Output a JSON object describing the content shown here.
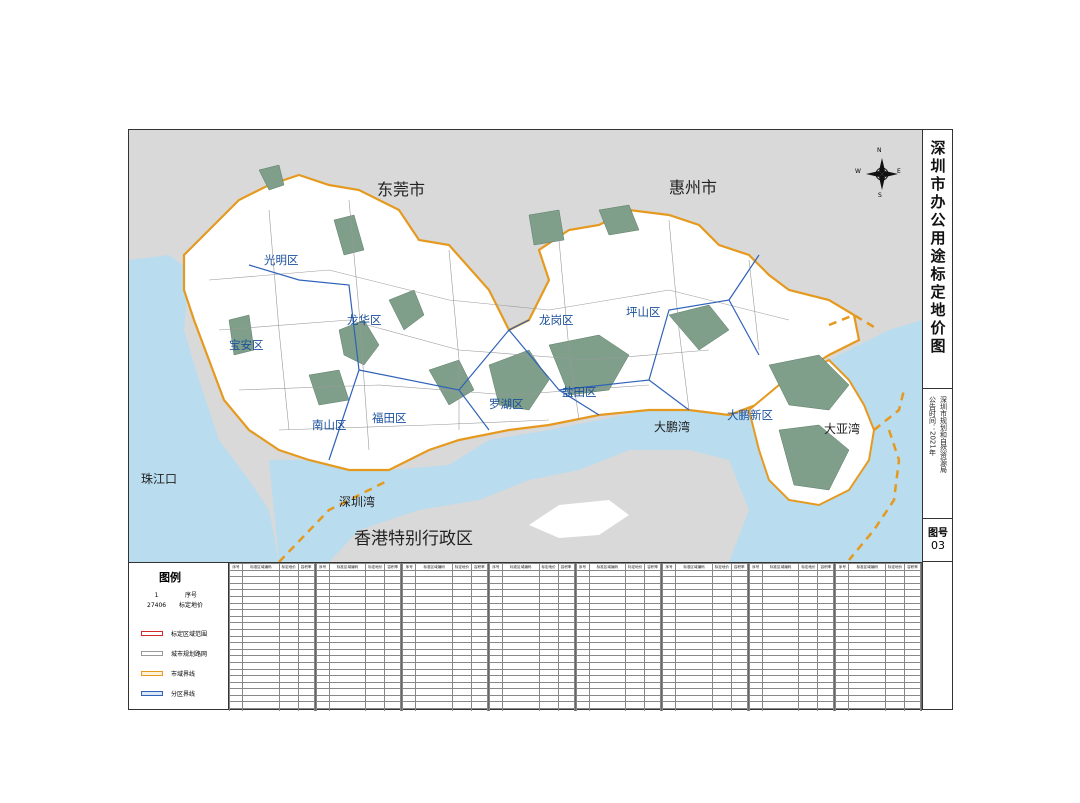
{
  "title": "深圳市办公用途标定地价图",
  "announce_date": "公告时间：2021年",
  "publisher": "深圳市规划和自然资源局",
  "figure_label": "图号",
  "figure_number": "03",
  "neighbors": {
    "dongguan": "东莞市",
    "huizhou": "惠州市",
    "hongkong": "香港特别行政区"
  },
  "waters": {
    "pearl_river": "珠江口",
    "shenzhen_bay": "深圳湾",
    "dapeng_bay": "大鹏湾",
    "daya_bay": "大亚湾"
  },
  "districts": {
    "guangming": "光明区",
    "baoan": "宝安区",
    "longhua": "龙华区",
    "longgang": "龙岗区",
    "pingshan": "坪山区",
    "nanshan": "南山区",
    "futian": "福田区",
    "luohu": "罗湖区",
    "yantian": "盐田区",
    "dapeng": "大鹏新区"
  },
  "compass": {
    "n": "N",
    "s": "S",
    "e": "E",
    "w": "W"
  },
  "legend": {
    "title": "图例",
    "sample_number": "1",
    "sample_price": "27406",
    "desc_number": "序号",
    "desc_price": "标定地价",
    "items": [
      {
        "label": "标定区域范围",
        "color": "#d42a2a"
      },
      {
        "label": "城市规划路网",
        "color": "#9a9a9a"
      },
      {
        "label": "市域界线",
        "color": "#e59a1f"
      },
      {
        "label": "分区界线",
        "color": "#2f62b8"
      }
    ]
  },
  "table_headers": [
    "序号",
    "标准区域编码",
    "标定地价",
    "容积率"
  ],
  "colors": {
    "sea": "#b9dcef",
    "land_outside": "#d9d9d9",
    "land": "#ffffff",
    "green": "#7f9f8a",
    "city_border": "#e59a1f",
    "district_border": "#2f62b8",
    "district_label": "#1a4f9c"
  }
}
